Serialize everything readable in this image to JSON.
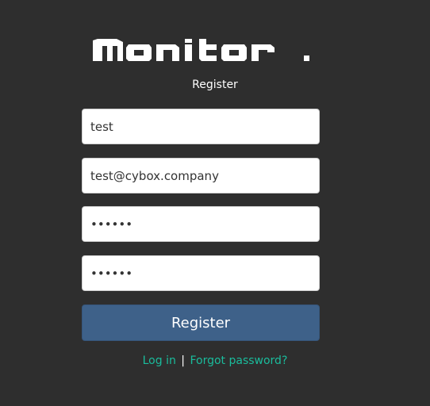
{
  "app": {
    "logo_text": "Monitor",
    "page_subtitle": "Register"
  },
  "form": {
    "username_value": "test",
    "email_value": "test@cybox.company",
    "password_value": "123456",
    "password_confirm_value": "123456",
    "submit_label": "Register"
  },
  "links": {
    "login_label": "Log in",
    "separator": "|",
    "forgot_label": "Forgot password?"
  },
  "colors": {
    "background": "#2e2e2e",
    "button": "#3e6189",
    "link": "#1abc9c"
  }
}
